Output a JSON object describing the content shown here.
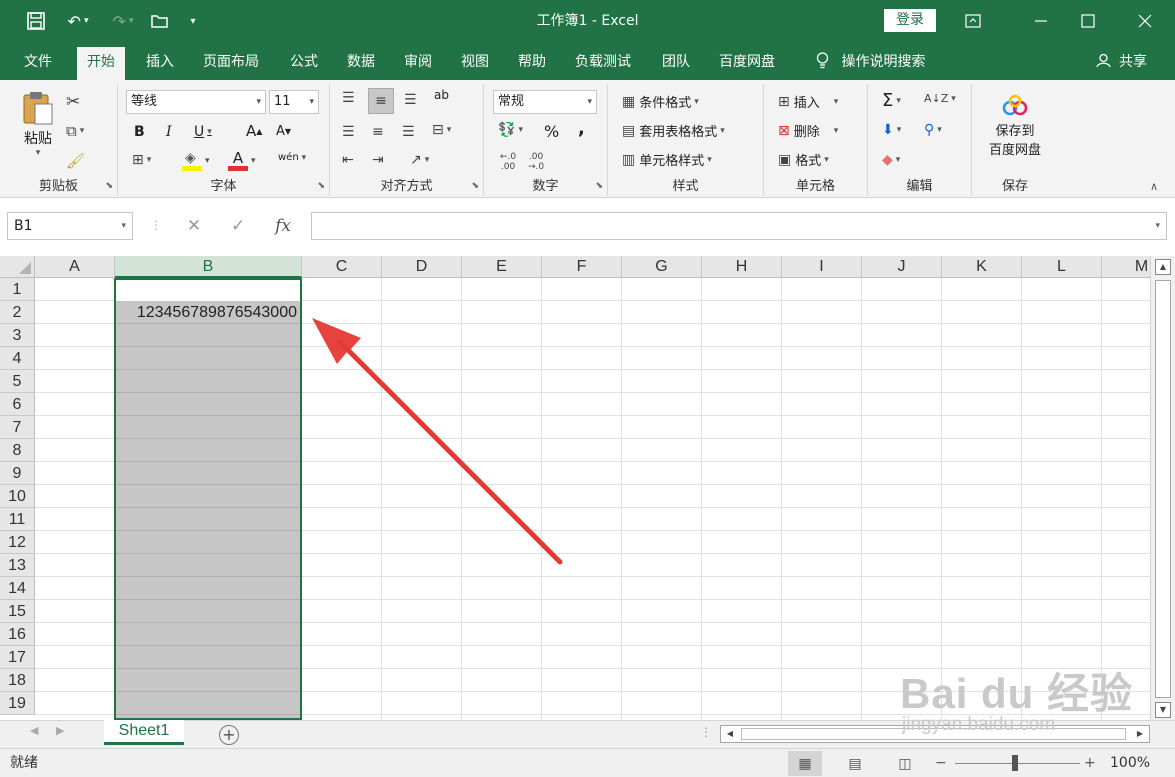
{
  "titlebar": {
    "title": "工作簿1  -  Excel",
    "login": "登录"
  },
  "menu": {
    "tabs": [
      "文件",
      "开始",
      "插入",
      "页面布局",
      "公式",
      "数据",
      "审阅",
      "视图",
      "帮助",
      "负载测试",
      "团队",
      "百度网盘"
    ],
    "active": "开始",
    "tell_me": "操作说明搜索",
    "share": "共享"
  },
  "ribbon": {
    "clipboard": {
      "label": "剪贴板",
      "paste": "粘贴"
    },
    "font": {
      "label": "字体",
      "font_name": "等线",
      "font_size": "11",
      "bold": "B",
      "italic": "I",
      "underline": "U",
      "grow": "A",
      "shrink": "A",
      "font_color": "A",
      "phonetic": "wén"
    },
    "alignment": {
      "label": "对齐方式",
      "wrap": "ab"
    },
    "number": {
      "label": "数字",
      "format": "常规",
      "percent": "%",
      "comma": ","
    },
    "styles": {
      "label": "样式",
      "conditional": "条件格式",
      "table": "套用表格格式",
      "cell_styles": "单元格样式"
    },
    "cells": {
      "label": "单元格",
      "insert": "插入",
      "delete": "删除",
      "format": "格式"
    },
    "editing": {
      "label": "编辑",
      "sum": "Σ"
    },
    "save": {
      "label": "保存",
      "button_line1": "保存到",
      "button_line2": "百度网盘"
    }
  },
  "formula_bar": {
    "name_box": "B1",
    "fx": "fx",
    "formula": ""
  },
  "sheet": {
    "columns": [
      "A",
      "B",
      "C",
      "D",
      "E",
      "F",
      "G",
      "H",
      "I",
      "J",
      "K",
      "L",
      "M"
    ],
    "selected_column": "B",
    "rows": [
      "1",
      "2",
      "3",
      "4",
      "5",
      "6",
      "7",
      "8",
      "9",
      "10",
      "11",
      "12",
      "13",
      "14",
      "15",
      "16",
      "17",
      "18",
      "19"
    ],
    "cell_B2": "123456789876543000"
  },
  "sheet_tabs": {
    "active": "Sheet1",
    "add": "+"
  },
  "status": {
    "text": "就绪",
    "zoom": "100%"
  },
  "watermark": {
    "main": "Bai du 经验",
    "sub": "jingyan.baidu.com"
  },
  "colors": {
    "excel_green": "#217346",
    "selection_gray": "#c6c6c6",
    "arrow_red": "#e53935"
  },
  "icons": [
    "save-icon",
    "undo-icon",
    "redo-icon",
    "open-icon",
    "customize-icon",
    "ribbon-options-icon",
    "minimize-icon",
    "maximize-icon",
    "close-icon",
    "lightbulb-icon",
    "user-icon"
  ]
}
